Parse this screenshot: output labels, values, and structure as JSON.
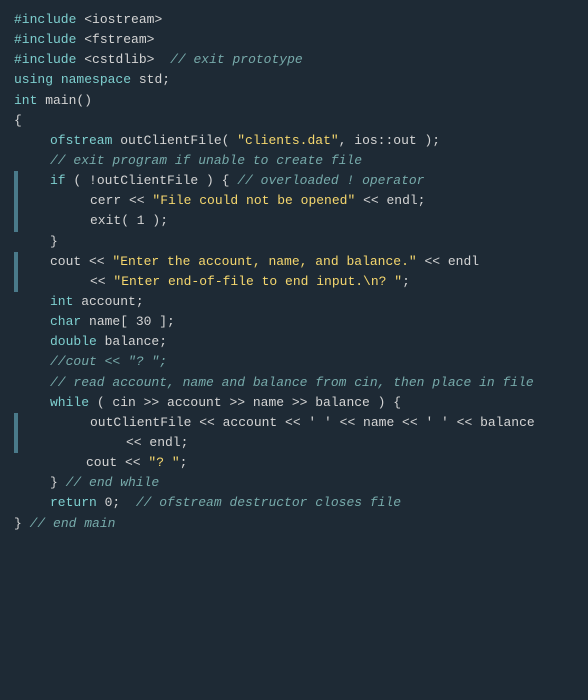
{
  "code": {
    "lines": [
      {
        "tokens": [
          {
            "cls": "kw",
            "t": "#include"
          },
          {
            "cls": "plain",
            "t": " "
          },
          {
            "cls": "plain",
            "t": "<iostream>"
          }
        ]
      },
      {
        "tokens": [
          {
            "cls": "kw",
            "t": "#include"
          },
          {
            "cls": "plain",
            "t": " "
          },
          {
            "cls": "plain",
            "t": "<fstream>"
          }
        ]
      },
      {
        "tokens": [
          {
            "cls": "kw",
            "t": "#include"
          },
          {
            "cls": "plain",
            "t": " "
          },
          {
            "cls": "plain",
            "t": "<cstdlib>"
          },
          {
            "cls": "plain",
            "t": "  "
          },
          {
            "cls": "comment",
            "t": "// exit prototype"
          }
        ]
      },
      {
        "tokens": [
          {
            "cls": "kw",
            "t": "using"
          },
          {
            "cls": "plain",
            "t": " "
          },
          {
            "cls": "kw",
            "t": "namespace"
          },
          {
            "cls": "plain",
            "t": " std;"
          }
        ]
      },
      {
        "tokens": []
      },
      {
        "tokens": [
          {
            "cls": "type",
            "t": "int"
          },
          {
            "cls": "plain",
            "t": " main()"
          }
        ]
      },
      {
        "tokens": [
          {
            "cls": "plain",
            "t": "{"
          }
        ]
      },
      {
        "indent": "1",
        "tokens": [
          {
            "cls": "type",
            "t": "ofstream"
          },
          {
            "cls": "plain",
            "t": " outClientFile( "
          },
          {
            "cls": "str",
            "t": "\"clients.dat\""
          },
          {
            "cls": "plain",
            "t": ", ios::out );"
          }
        ]
      },
      {
        "tokens": []
      },
      {
        "indent": "1",
        "tokens": [
          {
            "cls": "comment",
            "t": "// exit program if unable to create file"
          }
        ]
      },
      {
        "indent": "1",
        "bar": true,
        "tokens": [
          {
            "cls": "kw",
            "t": "if"
          },
          {
            "cls": "plain",
            "t": " ( !outClientFile ) { "
          },
          {
            "cls": "comment",
            "t": "// overloaded ! operator"
          }
        ]
      },
      {
        "indent": "2",
        "bar": true,
        "tokens": [
          {
            "cls": "plain",
            "t": "cerr << "
          },
          {
            "cls": "str",
            "t": "\"File could not be opened\""
          },
          {
            "cls": "plain",
            "t": " << endl;"
          }
        ]
      },
      {
        "indent": "2",
        "bar": true,
        "tokens": [
          {
            "cls": "plain",
            "t": "exit( 1 );"
          }
        ]
      },
      {
        "indent": "1",
        "tokens": [
          {
            "cls": "plain",
            "t": "}"
          }
        ]
      },
      {
        "tokens": []
      },
      {
        "indent": "1",
        "bar": true,
        "tokens": [
          {
            "cls": "plain",
            "t": "cout << "
          },
          {
            "cls": "str",
            "t": "\"Enter the account, name, and balance.\""
          },
          {
            "cls": "plain",
            "t": " << endl"
          }
        ]
      },
      {
        "indent": "2",
        "bar": true,
        "tokens": [
          {
            "cls": "plain",
            "t": "<< "
          },
          {
            "cls": "str",
            "t": "\"Enter end-of-file to end input.\\n? \""
          },
          {
            "cls": "plain",
            "t": ";"
          }
        ]
      },
      {
        "tokens": []
      },
      {
        "indent": "1",
        "tokens": [
          {
            "cls": "type",
            "t": "int"
          },
          {
            "cls": "plain",
            "t": " account;"
          }
        ]
      },
      {
        "indent": "1",
        "tokens": [
          {
            "cls": "type",
            "t": "char"
          },
          {
            "cls": "plain",
            "t": " name[ 30 ];"
          }
        ]
      },
      {
        "indent": "1",
        "tokens": [
          {
            "cls": "type",
            "t": "double"
          },
          {
            "cls": "plain",
            "t": " balance;"
          }
        ]
      },
      {
        "tokens": []
      },
      {
        "indent": "1",
        "tokens": [
          {
            "cls": "comment",
            "t": "//cout << \"? \";"
          }
        ]
      },
      {
        "indent": "1",
        "tokens": [
          {
            "cls": "comment",
            "t": "// read account, name and balance from cin, then place in file"
          }
        ]
      },
      {
        "indent": "1",
        "tokens": [
          {
            "cls": "kw",
            "t": "while"
          },
          {
            "cls": "plain",
            "t": " ( cin >> account >> name >> balance ) {"
          }
        ]
      },
      {
        "indent": "2",
        "bar": true,
        "tokens": [
          {
            "cls": "plain",
            "t": "outClientFile << account << ' ' << name << ' ' << balance"
          }
        ]
      },
      {
        "indent": "3",
        "bar": true,
        "tokens": [
          {
            "cls": "plain",
            "t": "<< endl;"
          }
        ]
      },
      {
        "indent": "2",
        "tokens": [
          {
            "cls": "plain",
            "t": "cout << "
          },
          {
            "cls": "str",
            "t": "\"? \""
          },
          {
            "cls": "plain",
            "t": ";"
          }
        ]
      },
      {
        "tokens": []
      },
      {
        "indent": "1",
        "tokens": [
          {
            "cls": "plain",
            "t": "} "
          },
          {
            "cls": "comment",
            "t": "// end while"
          }
        ]
      },
      {
        "tokens": []
      },
      {
        "indent": "1",
        "tokens": [
          {
            "cls": "kw",
            "t": "return"
          },
          {
            "cls": "plain",
            "t": " 0;  "
          },
          {
            "cls": "comment",
            "t": "// ofstream destructor closes file"
          }
        ]
      },
      {
        "tokens": [
          {
            "cls": "plain",
            "t": "} "
          },
          {
            "cls": "comment",
            "t": "// end main"
          }
        ]
      }
    ]
  }
}
